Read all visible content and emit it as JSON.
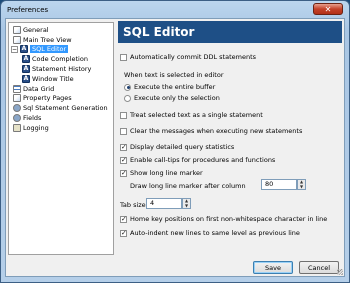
{
  "window": {
    "title": "Preferences",
    "close_label": "✕"
  },
  "tree": {
    "items": [
      {
        "label": "General",
        "icon": "page-icon"
      },
      {
        "label": "Main Tree View",
        "icon": "page-icon"
      },
      {
        "label": "SQL Editor",
        "icon": "a-icon",
        "expander": "−",
        "selected": true
      },
      {
        "label": "Code Completion",
        "icon": "a-icon"
      },
      {
        "label": "Statement History",
        "icon": "a-icon"
      },
      {
        "label": "Window Title",
        "icon": "a-icon"
      },
      {
        "label": "Data Grid",
        "icon": "grid-icon"
      },
      {
        "label": "Property Pages",
        "icon": "page-icon"
      },
      {
        "label": "Sql Statement Generation",
        "icon": "gear-icon"
      },
      {
        "label": "Fields",
        "icon": "gear-icon"
      },
      {
        "label": "Logging",
        "icon": "log-icon"
      }
    ]
  },
  "panel": {
    "header": "SQL Editor",
    "auto_commit": "Automatically commit DDL statements",
    "selected_text_label": "When text is selected in editor",
    "radio_entire": "Execute the entire buffer",
    "radio_selection": "Execute only the selection",
    "treat_single": "Treat selected text as a single statement",
    "clear_messages": "Clear the messages when executing new statements",
    "detailed_stats": "Display detailed query statistics",
    "call_tips": "Enable call-tips for procedures and functions",
    "long_line": "Show long line marker",
    "draw_after_label": "Draw long line marker after column",
    "draw_after_value": "80",
    "tab_size_label": "Tab size",
    "tab_size_value": "4",
    "home_key": "Home key positions on first non-whitespace character in line",
    "auto_indent": "Auto-indent new lines to same level as previous line"
  },
  "buttons": {
    "save": "Save",
    "cancel": "Cancel"
  },
  "colors": {
    "header_bg": "#1e4f86",
    "selection": "#3399ff"
  }
}
